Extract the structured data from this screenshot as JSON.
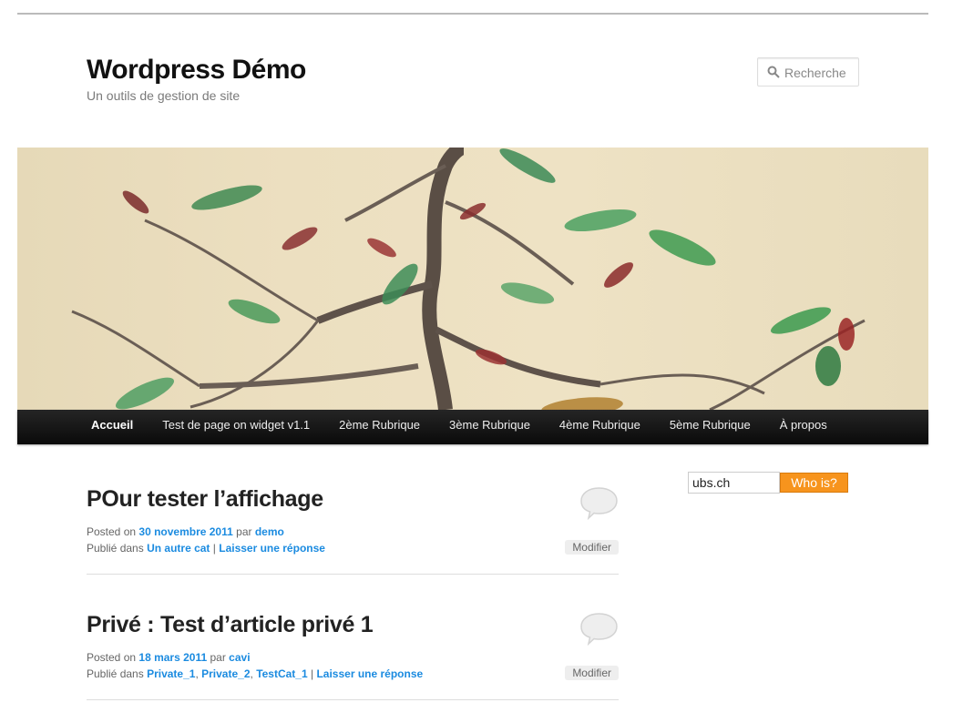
{
  "site": {
    "title": "Wordpress Démo",
    "description": "Un outils de gestion de site"
  },
  "search": {
    "placeholder": "Recherche"
  },
  "nav": {
    "items": [
      {
        "label": "Accueil"
      },
      {
        "label": "Test de page on widget v1.1"
      },
      {
        "label": "2ème Rubrique"
      },
      {
        "label": "3ème Rubrique"
      },
      {
        "label": "4ème Rubrique"
      },
      {
        "label": "5ème Rubrique"
      },
      {
        "label": "À propos"
      }
    ]
  },
  "whois": {
    "value": "ubs.ch",
    "button_label": "Who is?"
  },
  "posts": [
    {
      "title": "POur tester l’affichage",
      "posted_on": "Posted on",
      "date": "30 novembre 2011",
      "par": "par",
      "author": "demo",
      "publie_dans": "Publié dans",
      "categories": [
        "Un autre cat"
      ],
      "sep": "|",
      "reply": "Laisser une réponse",
      "edit": "Modifier"
    },
    {
      "title": "Privé : Test d’article privé 1",
      "posted_on": "Posted on",
      "date": "18 mars 2011",
      "par": "par",
      "author": "cavi",
      "publie_dans": "Publié dans",
      "categories": [
        "Private_1",
        "Private_2",
        "TestCat_1"
      ],
      "comma": ",",
      "sep": "|",
      "reply": "Laisser une réponse",
      "edit": "Modifier"
    }
  ]
}
